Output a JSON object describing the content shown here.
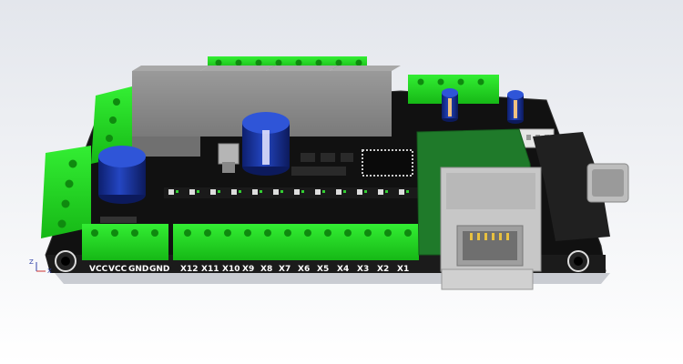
{
  "board": {
    "silkscreen_labels": [
      "VCC",
      "VCC",
      "GND",
      "GND",
      "X12",
      "X11",
      "X10",
      "X9",
      "X8",
      "X7",
      "X6",
      "X5",
      "X4",
      "X3",
      "X2",
      "X1"
    ],
    "axis_labels": {
      "z": "Z",
      "x": "X"
    }
  },
  "colors": {
    "board": "#111111",
    "terminal_green": "#22dd22",
    "relay_gray": "#8d8d8d",
    "capacitor_blue": "#1a35a8",
    "daughterboard_green": "#1f7a2a",
    "rj45_gray": "#c7c7c7",
    "db9_black": "#202020"
  },
  "icons": [
    "axis-gizmo-icon"
  ]
}
